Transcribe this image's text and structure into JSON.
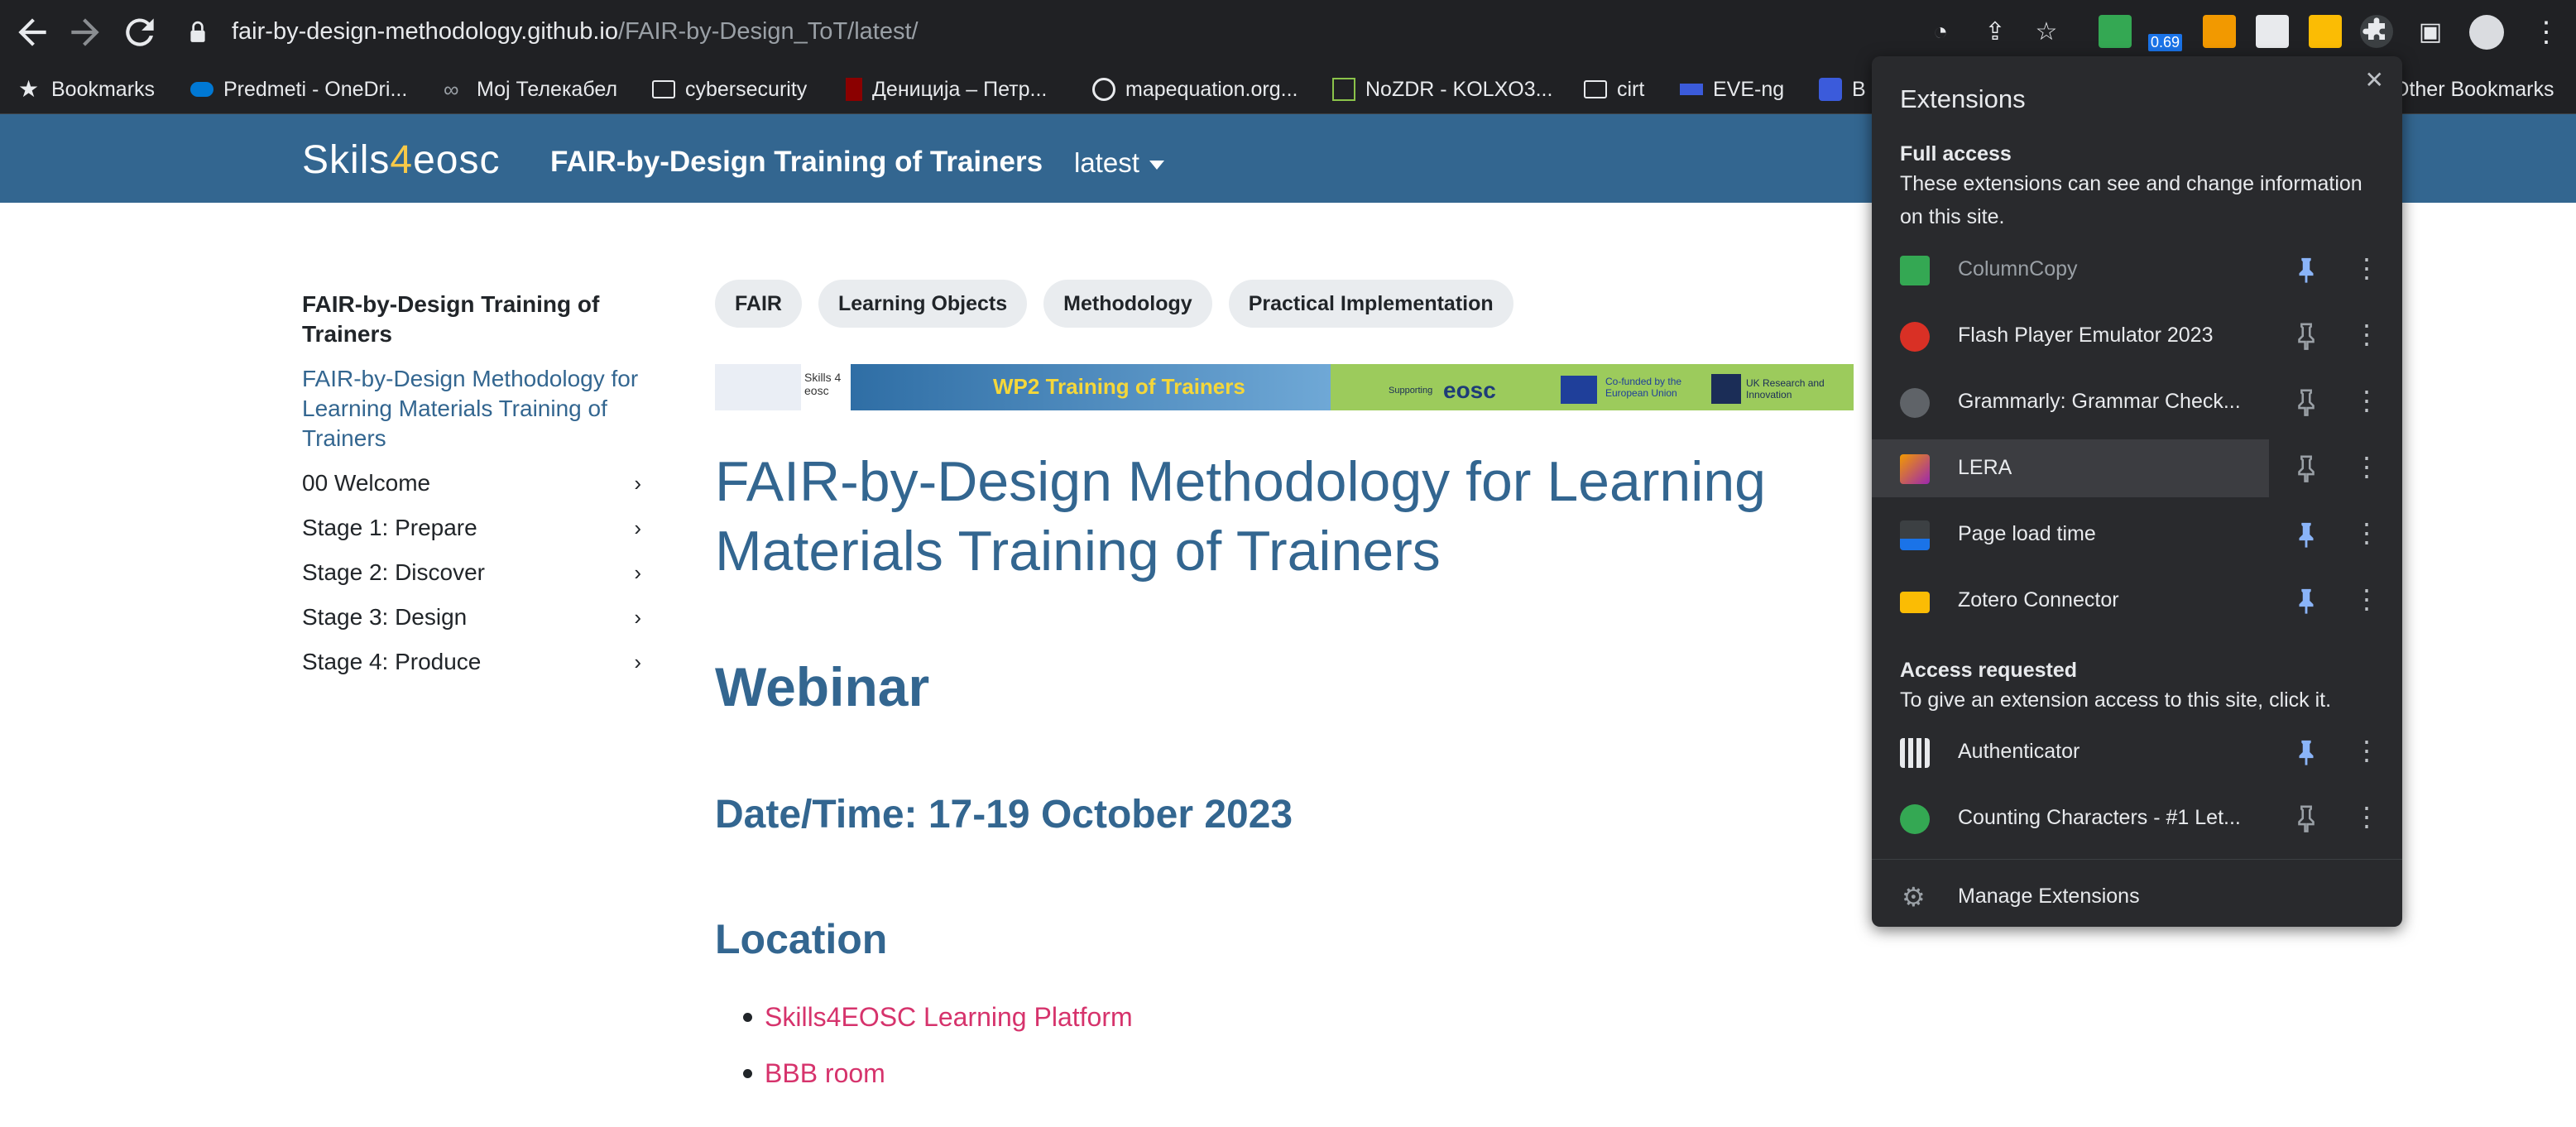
{
  "browser": {
    "url_host": "fair-by-design-methodology.github.io",
    "url_path": "/FAIR-by-Design_ToT/latest/",
    "toolbar_badge": "0.69"
  },
  "bookmarks": [
    {
      "label": "Bookmarks",
      "icon": "star-icon"
    },
    {
      "label": "Predmeti - OneDri...",
      "icon": "onedrive-icon"
    },
    {
      "label": "Мој Телекабел",
      "icon": "link-icon"
    },
    {
      "label": "cybersecurity",
      "icon": "folder-icon"
    },
    {
      "label": "Деницијa – Петр...",
      "icon": "site-icon"
    },
    {
      "label": "mapequation.org...",
      "icon": "globe-icon"
    },
    {
      "label": "NoZDR - KOLXO3...",
      "icon": "site-icon"
    },
    {
      "label": "cirt",
      "icon": "folder-icon"
    },
    {
      "label": "EVE-ng",
      "icon": "site-icon"
    },
    {
      "label": "B",
      "icon": "puzzle-icon"
    },
    {
      "label": "Other Bookmarks",
      "icon": "folder-icon"
    }
  ],
  "site": {
    "logo_left": "Ski",
    "logo_mid": "ls",
    "logo_four": "4",
    "logo_right": "eosc",
    "title": "FAIR-by-Design Training of Trainers",
    "version": "latest"
  },
  "sidebar": {
    "title": "FAIR-by-Design Training of Trainers",
    "current": "FAIR-by-Design Methodology for Learning Materials Training of Trainers",
    "items": [
      {
        "label": "00 Welcome"
      },
      {
        "label": "Stage 1: Prepare"
      },
      {
        "label": "Stage 2: Discover"
      },
      {
        "label": "Stage 3: Design"
      },
      {
        "label": "Stage 4: Produce"
      }
    ]
  },
  "tags": [
    "FAIR",
    "Learning Objects",
    "Methodology",
    "Practical Implementation"
  ],
  "banner": {
    "skills_text": "Skills 4 eosc",
    "headline": "WP2 Training of Trainers",
    "supporting": "Supporting",
    "eosc": "eosc",
    "eu_text": "Co-funded by the European Union",
    "uk_text": "UK Research and Innovation"
  },
  "content": {
    "heading": "FAIR-by-Design Methodology for Learning Materials Training of Trainers",
    "webinar": "Webinar",
    "datetime": "Date/Time: 17-19 October 2023",
    "location": "Location",
    "links": [
      "Skills4EOSC Learning Platform",
      "BBB room"
    ]
  },
  "extensions": {
    "title": "Extensions",
    "full_access_head": "Full access",
    "full_access_desc": "These extensions can see and change information on this site.",
    "full_access": [
      {
        "name": "ColumnCopy",
        "pinned": true,
        "color": "#34a853"
      },
      {
        "name": "Flash Player Emulator 2023",
        "pinned": false,
        "color": "#d93025"
      },
      {
        "name": "Grammarly: Grammar Check...",
        "pinned": false,
        "color": "#5f6368"
      },
      {
        "name": "LERA",
        "pinned": false,
        "color": "#f29900"
      },
      {
        "name": "Page load time",
        "pinned": true,
        "color": "#1a73e8"
      },
      {
        "name": "Zotero Connector",
        "pinned": true,
        "color": "#fbbc04"
      }
    ],
    "requested_head": "Access requested",
    "requested_desc": "To give an extension access to this site, click it.",
    "requested": [
      {
        "name": "Authenticator",
        "pinned": true,
        "color": "#ffffff"
      },
      {
        "name": "Counting Characters - #1 Let...",
        "pinned": false,
        "color": "#34a853"
      }
    ],
    "manage": "Manage Extensions",
    "pin_color": "#8ab4f8"
  }
}
